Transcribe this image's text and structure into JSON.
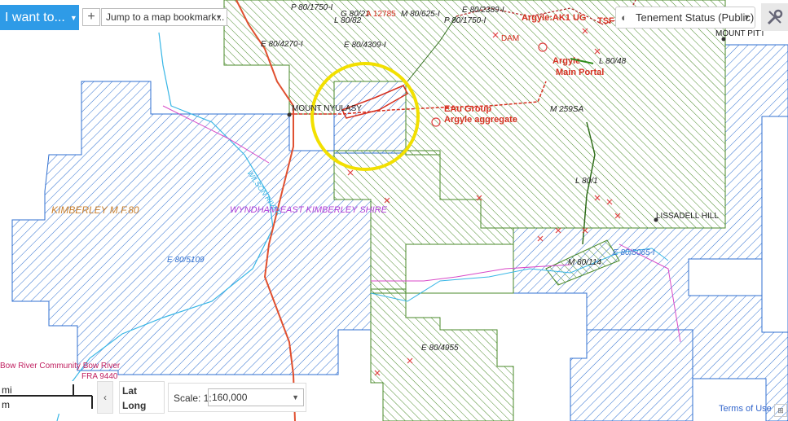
{
  "toolbar": {
    "i_want_to": "I want to...",
    "add_label": "+",
    "bookmark_label": "Jump to a map bookmark...",
    "tenement_label": "Tenement Status (Public)"
  },
  "map": {
    "tenements": {
      "e80_4270": "E 80/4270-I",
      "e80_4309": "E 80/4309-I",
      "e80_5109": "E 80/5109",
      "e80_4955": "E 80/4955",
      "e80_5065": "E 80/5065-I",
      "e80_2389": "E 80/2389-I",
      "e80_1750": "P 80/1750-I",
      "p80_1750a": "P 80/1750-I",
      "p80_1750b": "P 80/1750-I",
      "l80_82": "L 80/82",
      "m80_625": "M 80/625-I",
      "l80_48": "L 80/48",
      "l80_1": "L 80/1",
      "m80_114": "M 80/114",
      "m259sa": "M 259SA",
      "g80_21": "G 80/21",
      "fra": "FRA 9440"
    },
    "places": {
      "mount_nyulasy": "MOUNT NYULASY",
      "mount_pitt": "MOUNT PITT",
      "lissadell": "LISSADELL HILL",
      "kimberley": "KIMBERLEY M.F.80",
      "wyndham": "WYNDHAM-EAST KIMBERLEY SHIRE",
      "bow_river": "Bow River Community Bow River",
      "wilson": "WILSON RIVER"
    },
    "features": {
      "argyle_ak": "Argyle:AK1 UG",
      "tsf": "TSF",
      "main_portal": "Main Portal",
      "argyle": "Argyle",
      "eau_group": "EAu Group",
      "argyle_aggregate": "Argyle aggregate",
      "dam": "DAM",
      "red_label": "A 12785"
    }
  },
  "bottom": {
    "unit_mi": "mi",
    "unit_m": "m",
    "collapse": "‹",
    "lat": "Lat",
    "long": "Long",
    "scale_label": "Scale: 1:",
    "scale_value": "160,000",
    "terms": "Terms of Use"
  },
  "colors": {
    "blue_hatch": "#2f6fd0",
    "green_hatch": "#4a8a2a",
    "road": "#e05030",
    "highlight_circle": "#f2e000",
    "river": "#38b6e6"
  },
  "icons": {
    "layers": "layers-icon",
    "tools": "tools-icon",
    "caret": "chevron-down-icon"
  }
}
